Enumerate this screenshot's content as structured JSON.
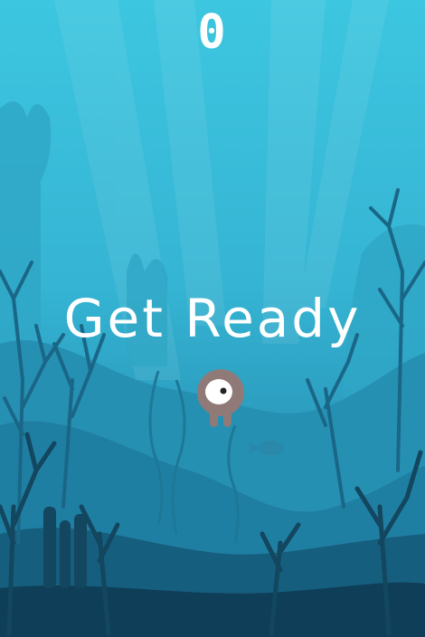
{
  "hud": {
    "score": "0"
  },
  "overlay": {
    "message": "Get Ready"
  },
  "player": {
    "character": "octopus-icon",
    "body_color": "#8f7a78",
    "eye_color": "#ffffff"
  },
  "colors": {
    "water_top": "#3dc6e0",
    "water_bottom": "#0f3e58",
    "coral_dark": "#13465f"
  }
}
